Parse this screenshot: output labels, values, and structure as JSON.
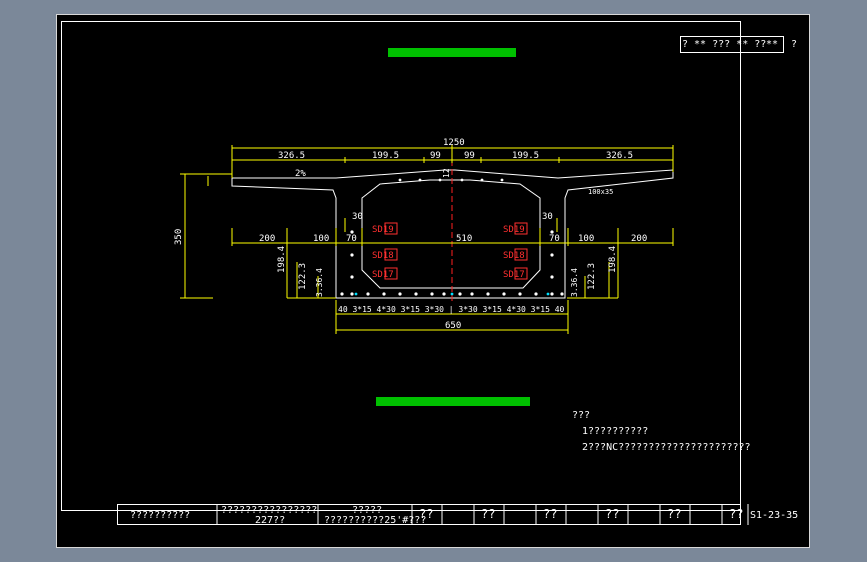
{
  "title_block": {
    "left_text": "? ** ??? ** ??",
    "right_text": "**",
    "page_mark": "?"
  },
  "section": {
    "top_label": "?????????????????",
    "bottom_label": "????????????????????????",
    "dims": {
      "overall": "1250",
      "cantilever_left": "326.5",
      "web_left": "199.5",
      "half_left": "99",
      "half_right": "99",
      "web_right": "199.5",
      "cantilever_right": "326.5",
      "height": "350",
      "chamfer": "100x35",
      "slope": "2%",
      "top_thk": "12",
      "haunch_left": "30",
      "haunch_right": "30",
      "bot_left_a": "200",
      "bot_left_b": "100",
      "bot_left_c": "70",
      "bot_center": "510",
      "bot_right_c": "70",
      "bot_right_b": "100",
      "bot_right_a": "200",
      "web_h_left": "198.4",
      "web_h_right": "198.4",
      "inner_h_left": "122.3",
      "inner_h_right": "122.3",
      "small_left": "3.36.4",
      "small_right": "3.36.4",
      "bottom_width": "650",
      "spacing_row": "40 3*15  4*30  3*15 3*30 | 3*30 3*15  4*30  3*15 40"
    },
    "tendons": {
      "left": [
        "SD19",
        "SD18",
        "SD17"
      ],
      "right": [
        "SD19",
        "SD18",
        "SD17"
      ]
    }
  },
  "notes": {
    "heading": "???",
    "line1": "1??????????",
    "line2": "2???NC??????????????????????"
  },
  "footer": {
    "cells": [
      "??????????",
      "????????????????",
      "227??",
      "?????",
      "??????????25'#???",
      "??",
      "??",
      "??",
      "??",
      "??",
      "??"
    ],
    "drawing_no": "S1-23-35"
  },
  "colors": {
    "background": "#000000",
    "outer": "#7b8899",
    "line": "#ffffff",
    "dimension": "#ffff00",
    "centerline": "#ff2020",
    "tendon": "#ff3030",
    "highlight": "#00ff00"
  }
}
